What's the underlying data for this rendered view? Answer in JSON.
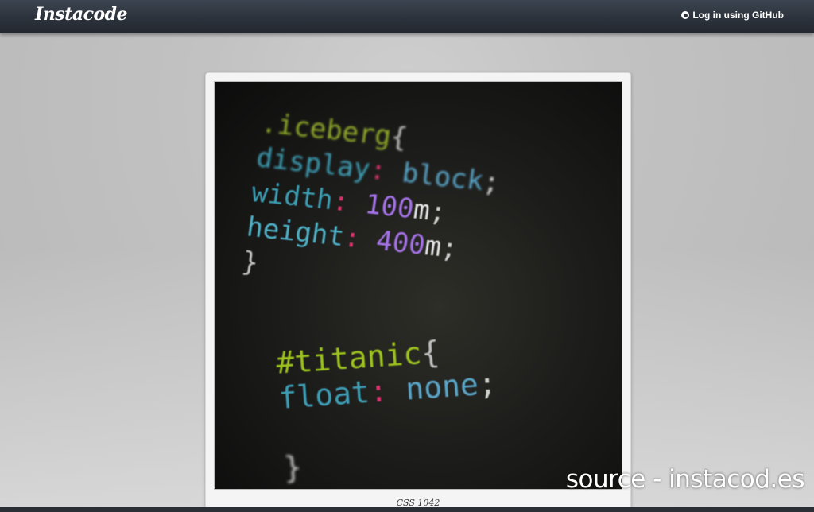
{
  "header": {
    "logo": "Instacode",
    "login_label": "Log in using GitHub",
    "login_icon": "github-icon"
  },
  "image": {
    "code_lines_top": [
      [
        {
          "t": ".iceberg",
          "k": "sel"
        },
        {
          "t": "{",
          "k": "brace"
        }
      ],
      [
        {
          "t": "display",
          "k": "prop"
        },
        {
          "t": ": ",
          "k": "colon"
        },
        {
          "t": "block",
          "k": "val"
        },
        {
          "t": ";",
          "k": "punc"
        }
      ],
      [
        {
          "t": "width",
          "k": "prop"
        },
        {
          "t": ": ",
          "k": "colon"
        },
        {
          "t": "100",
          "k": "num"
        },
        {
          "t": "m",
          "k": "unit"
        },
        {
          "t": ";",
          "k": "punc"
        }
      ],
      [
        {
          "t": "height",
          "k": "prop2"
        },
        {
          "t": ": ",
          "k": "colon"
        },
        {
          "t": "400",
          "k": "num"
        },
        {
          "t": "m",
          "k": "unit"
        },
        {
          "t": ";",
          "k": "punc"
        }
      ],
      [
        {
          "t": "}",
          "k": "brace"
        }
      ]
    ],
    "code_lines_bottom": [
      [
        {
          "t": "#titanic",
          "k": "sel2"
        },
        {
          "t": "{",
          "k": "brace"
        }
      ],
      [
        {
          "t": "float",
          "k": "prop"
        },
        {
          "t": ": ",
          "k": "colon"
        },
        {
          "t": "none",
          "k": "val"
        },
        {
          "t": ";",
          "k": "punc"
        }
      ],
      [
        {
          "t": "",
          "k": "punc"
        }
      ],
      [
        {
          "t": "}",
          "k": "brace"
        }
      ]
    ],
    "caption": "CSS 1042"
  },
  "watermark": "source - instacod.es",
  "colors": {
    "header_bg": "#2d333c",
    "selector": "#8faa2a",
    "property": "#3d9db3",
    "colon": "#d7336c",
    "number": "#a472e6"
  }
}
